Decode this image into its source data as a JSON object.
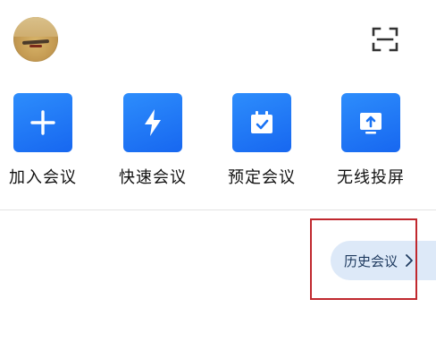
{
  "header": {
    "avatar_icon": "user-avatar-photo",
    "scan_icon": "scan-icon"
  },
  "actions": [
    {
      "label": "加入会议",
      "icon": "plus-icon"
    },
    {
      "label": "快速会议",
      "icon": "lightning-icon"
    },
    {
      "label": "预定会议",
      "icon": "calendar-check-icon"
    },
    {
      "label": "无线投屏",
      "icon": "screen-share-icon"
    }
  ],
  "history": {
    "label": "历史会议",
    "icon": "chevron-right-icon"
  },
  "colors": {
    "accent": "#1a73f5",
    "history_bg": "#dde9f8",
    "highlight_box": "#c0282e"
  }
}
